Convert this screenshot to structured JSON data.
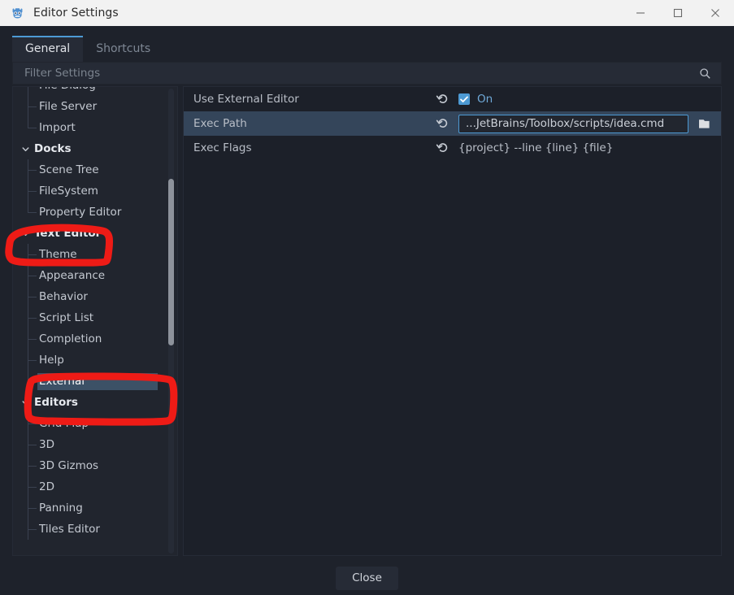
{
  "window": {
    "title": "Editor Settings",
    "icon": "godot-robot-icon",
    "controls": [
      {
        "name": "minimize-button",
        "glyph": "minimize-icon"
      },
      {
        "name": "maximize-button",
        "glyph": "maximize-icon"
      },
      {
        "name": "close-button",
        "glyph": "close-icon"
      }
    ]
  },
  "tabs": [
    {
      "label": "General",
      "active": true
    },
    {
      "label": "Shortcuts",
      "active": false
    }
  ],
  "search": {
    "placeholder": "Filter Settings",
    "icon": "search-icon"
  },
  "sidebar": {
    "scrollbar": "vertical-scrollbar",
    "items": [
      {
        "label": "File Dialog",
        "type": "leaf",
        "selected": false
      },
      {
        "label": "File Server",
        "type": "leaf",
        "selected": false
      },
      {
        "label": "Import",
        "type": "leaf",
        "selected": false,
        "last": true
      },
      {
        "label": "Docks",
        "type": "group",
        "selected": false
      },
      {
        "label": "Scene Tree",
        "type": "leaf",
        "selected": false
      },
      {
        "label": "FileSystem",
        "type": "leaf",
        "selected": false
      },
      {
        "label": "Property Editor",
        "type": "leaf",
        "selected": false,
        "last": true
      },
      {
        "label": "Text Editor",
        "type": "group",
        "selected": false
      },
      {
        "label": "Theme",
        "type": "leaf",
        "selected": false
      },
      {
        "label": "Appearance",
        "type": "leaf",
        "selected": false
      },
      {
        "label": "Behavior",
        "type": "leaf",
        "selected": false
      },
      {
        "label": "Script List",
        "type": "leaf",
        "selected": false
      },
      {
        "label": "Completion",
        "type": "leaf",
        "selected": false
      },
      {
        "label": "Help",
        "type": "leaf",
        "selected": false
      },
      {
        "label": "External",
        "type": "leaf",
        "selected": true,
        "last": true
      },
      {
        "label": "Editors",
        "type": "group",
        "selected": false
      },
      {
        "label": "Grid Map",
        "type": "leaf",
        "selected": false
      },
      {
        "label": "3D",
        "type": "leaf",
        "selected": false
      },
      {
        "label": "3D Gizmos",
        "type": "leaf",
        "selected": false
      },
      {
        "label": "2D",
        "type": "leaf",
        "selected": false
      },
      {
        "label": "Panning",
        "type": "leaf",
        "selected": false
      },
      {
        "label": "Tiles Editor",
        "type": "leaf",
        "selected": false
      }
    ]
  },
  "properties": [
    {
      "label": "Use External Editor",
      "control": "checkbox",
      "value": "On",
      "checked": true,
      "revert_icon": "revert-icon",
      "selected": false
    },
    {
      "label": "Exec Path",
      "control": "text",
      "value": "...JetBrains/Toolbox/scripts/idea.cmd",
      "browse_icon": "folder-icon",
      "revert_icon": "revert-icon",
      "selected": true
    },
    {
      "label": "Exec Flags",
      "control": "plaintext",
      "value": "{project} --line {line} {file}",
      "revert_icon": "revert-icon",
      "selected": false
    }
  ],
  "footer": {
    "close_label": "Close"
  },
  "annotations": {
    "color": "#ee1b16",
    "marks": [
      {
        "name": "annotation-text-editor",
        "target": "Text Editor"
      },
      {
        "name": "annotation-external",
        "target": "External"
      }
    ]
  },
  "colors": {
    "accent": "#4d9ad4",
    "titlebar": "#f2f2f2",
    "app_bg": "#1e222b",
    "panel_bg": "#1c2029",
    "sidebar_bg": "#21252e",
    "selection": "#3c5166",
    "row_selection": "#34455a",
    "annotation_red": "#ee1b16"
  }
}
